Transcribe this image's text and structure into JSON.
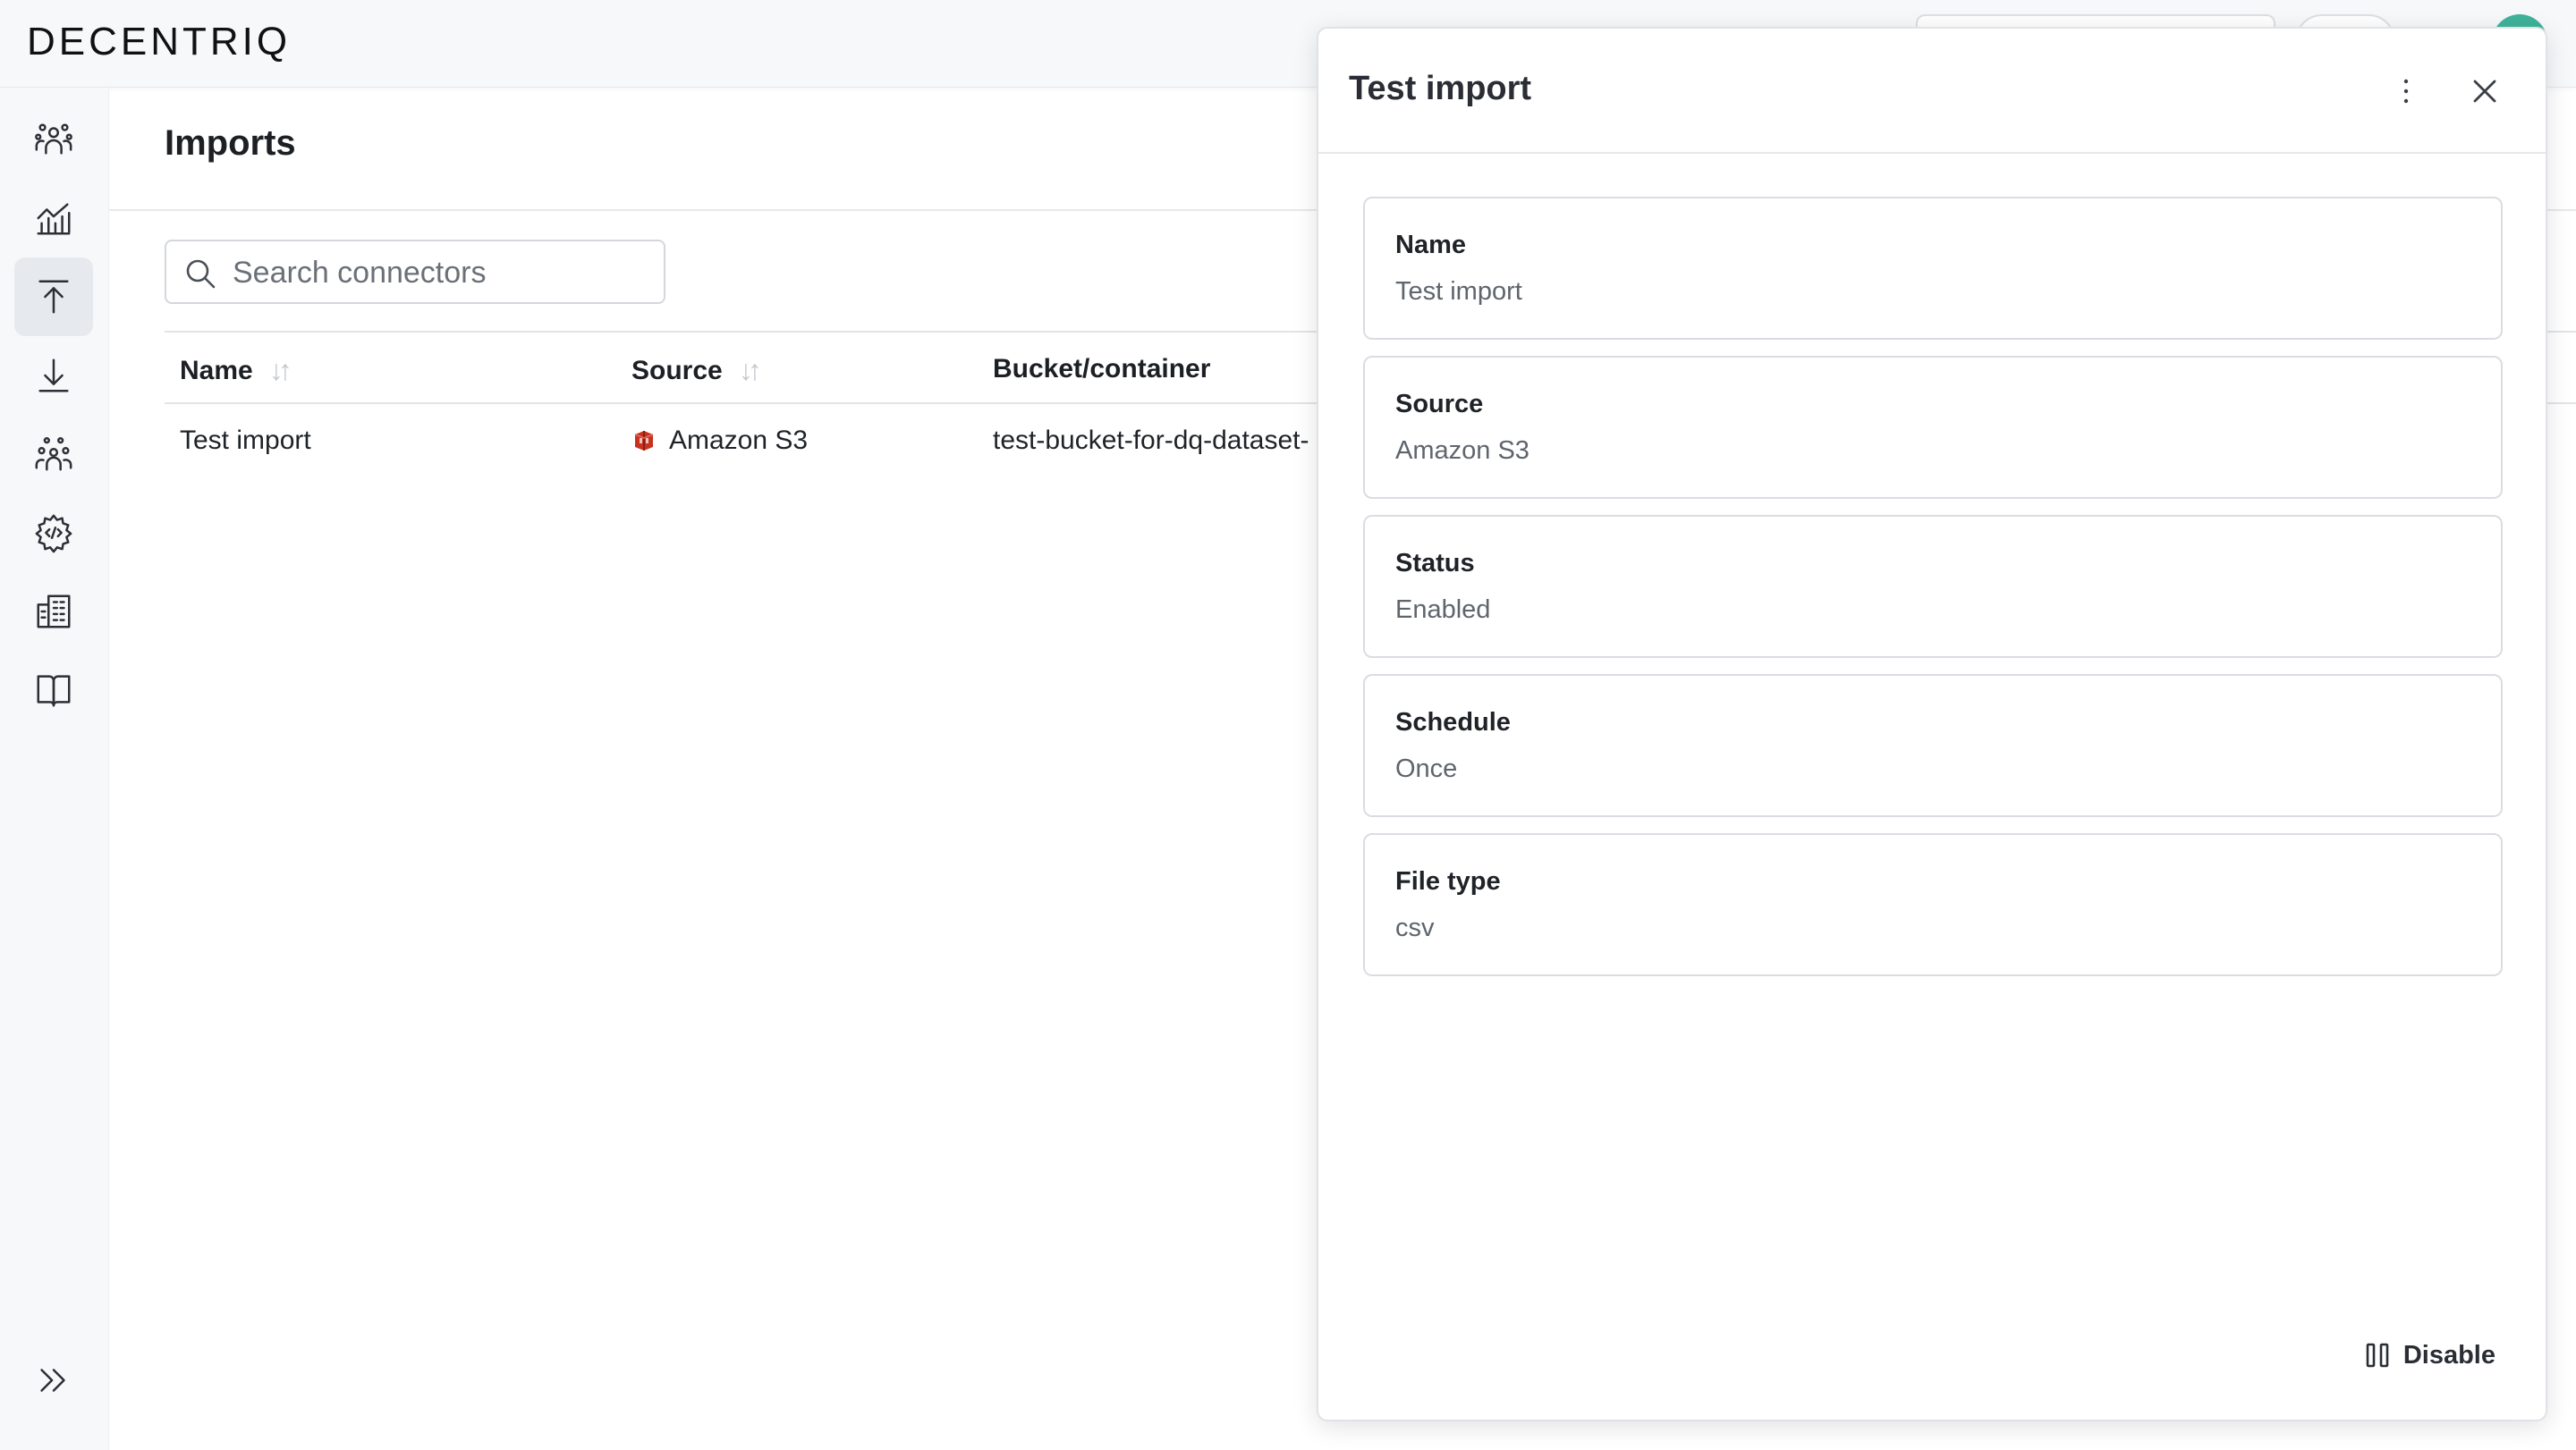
{
  "app": {
    "logo_text": "DECENTRIQ"
  },
  "sidebar": {
    "items": [
      {
        "name": "collaboration",
        "icon": "people-group-icon"
      },
      {
        "name": "insights",
        "icon": "chart-line-icon"
      },
      {
        "name": "imports",
        "icon": "upload-icon",
        "active": true
      },
      {
        "name": "exports",
        "icon": "download-icon"
      },
      {
        "name": "audiences",
        "icon": "crowd-icon"
      },
      {
        "name": "developer",
        "icon": "code-gear-icon"
      },
      {
        "name": "organization",
        "icon": "building-icon"
      },
      {
        "name": "docs",
        "icon": "book-icon"
      }
    ],
    "expand_icon": "chevron-double-right-icon"
  },
  "main": {
    "title": "Imports",
    "search": {
      "placeholder": "Search connectors",
      "value": ""
    },
    "table": {
      "columns": [
        "Name",
        "Source",
        "Bucket/container"
      ],
      "rows": [
        {
          "name": "Test import",
          "source": "Amazon S3",
          "bucket": "test-bucket-for-dq-dataset-"
        }
      ]
    }
  },
  "panel": {
    "title": "Test import",
    "fields": [
      {
        "label": "Name",
        "value": "Test import"
      },
      {
        "label": "Source",
        "value": "Amazon S3"
      },
      {
        "label": "Status",
        "value": "Enabled"
      },
      {
        "label": "Schedule",
        "value": "Once"
      },
      {
        "label": "File type",
        "value": "csv"
      }
    ],
    "disable_label": "Disable"
  },
  "colors": {
    "avatar": "#3fb39a",
    "s3_brand": "#c7331f"
  }
}
